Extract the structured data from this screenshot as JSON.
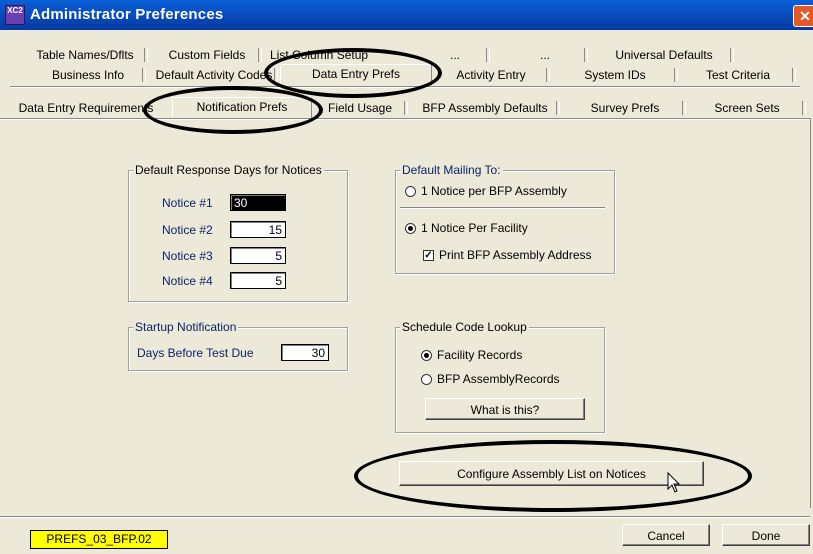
{
  "window": {
    "title": "Administrator Preferences",
    "app_icon_text": "XC2",
    "close_glyph": "✕"
  },
  "tabs": {
    "row1": [
      "Table Names/Dflts",
      "Custom Fields",
      "List Column Setup",
      "...",
      "...",
      "Universal Defaults"
    ],
    "row2": [
      "Business Info",
      "Default Activity Codes",
      "Data Entry Prefs",
      "Activity Entry",
      "System IDs",
      "Test Criteria"
    ],
    "row3": [
      "Data Entry Requirements",
      "Notification Prefs",
      "Field Usage",
      "BFP Assembly Defaults",
      "Survey Prefs",
      "Screen Sets"
    ]
  },
  "response_days": {
    "legend": "Default Response Days for Notices",
    "notices": [
      {
        "label": "Notice #1",
        "value": "30"
      },
      {
        "label": "Notice #2",
        "value": "15"
      },
      {
        "label": "Notice #3",
        "value": "5"
      },
      {
        "label": "Notice #4",
        "value": "5"
      }
    ]
  },
  "mailing": {
    "legend": "Default Mailing To:",
    "option1": "1 Notice per BFP Assembly",
    "option2": "1 Notice Per Facility",
    "checkbox_label": "Print BFP Assembly Address",
    "selected": "1 Notice Per Facility",
    "print_address_checked": true
  },
  "startup": {
    "legend": "Startup Notification",
    "label": "Days Before Test Due",
    "value": "30"
  },
  "schedule": {
    "legend": "Schedule Code Lookup",
    "option1": "Facility Records",
    "option2": "BFP AssemblyRecords",
    "selected": "Facility Records",
    "what_button": "What is this?"
  },
  "configure_button": "Configure Assembly List on Notices",
  "footer": {
    "status_code": "PREFS_03_BFP.02",
    "cancel": "Cancel",
    "done": "Done"
  },
  "colors": {
    "title_bar": "#0848b8",
    "label_blue": "#0a246a",
    "status_bg": "#ffff00",
    "window_bg": "#ece9d8"
  },
  "icons": [
    "app-icon",
    "close-icon",
    "mouse-pointer-icon"
  ]
}
